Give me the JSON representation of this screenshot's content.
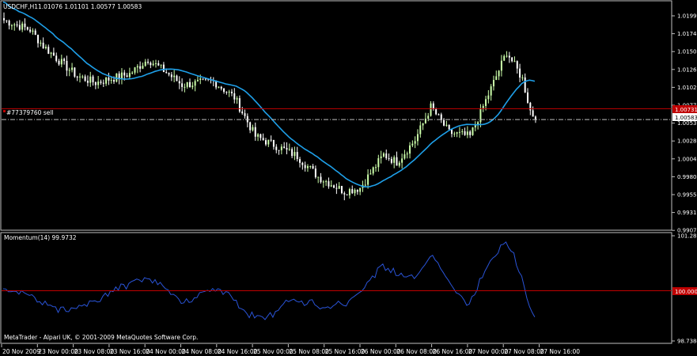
{
  "chart_header": {
    "symbol_label": "USDCHF,H1",
    "ohlc": "1.01076 1.01101 1.00577 1.00583"
  },
  "order_line_label": "#77379760 sell",
  "indicator_label": "Momentum(14) 99.9732",
  "copyright": "MetaTrader - Alpari UK, © 2001-2009 MetaQuotes Software Corp.",
  "colors": {
    "background": "#000000",
    "panel_border": "#c0c0c0",
    "bull_candle": "#ccffaa",
    "bear_candle": "#ffffff",
    "moving_average": "#1e9fe8",
    "momentum": "#2a54d8",
    "order_line": "#c00000",
    "current_price_tag": "#c00000"
  },
  "price_axis_labels": [
    "1.01990",
    "1.01745",
    "1.01505",
    "1.01260",
    "1.01020",
    "1.00775",
    "1.00530",
    "1.00285",
    "1.00045",
    "0.99800",
    "0.99555",
    "0.99315",
    "0.99070"
  ],
  "current_price_tag": "1.00583",
  "order_price_tag": "1.00731",
  "momentum_axis_labels": [
    "101.281",
    "100.000",
    "98.7384"
  ],
  "date_axis_labels": [
    "20 Nov 2009",
    "23 Nov 00:00",
    "23 Nov 08:00",
    "23 Nov 16:00",
    "24 Nov 00:00",
    "24 Nov 08:00",
    "24 Nov 16:00",
    "25 Nov 00:00",
    "25 Nov 08:00",
    "25 Nov 16:00",
    "26 Nov 00:00",
    "26 Nov 08:00",
    "26 Nov 16:00",
    "27 Nov 00:00",
    "27 Nov 08:00",
    "27 Nov 16:00"
  ],
  "chart_data": {
    "type": "candlestick",
    "main_chart": {
      "series": [
        {
          "name": "USDCHF,H1",
          "kind": "candles"
        },
        {
          "kind": "moving-average"
        }
      ],
      "ylim": [
        0.9907,
        1.0199
      ],
      "order_line_price": 1.00731,
      "current_price": 1.00583
    },
    "indicator": {
      "series": [
        {
          "name": "Momentum(14)",
          "kind": "line"
        }
      ],
      "ylim": [
        98.7384,
        101.281
      ],
      "reference_level": 100.0
    }
  }
}
